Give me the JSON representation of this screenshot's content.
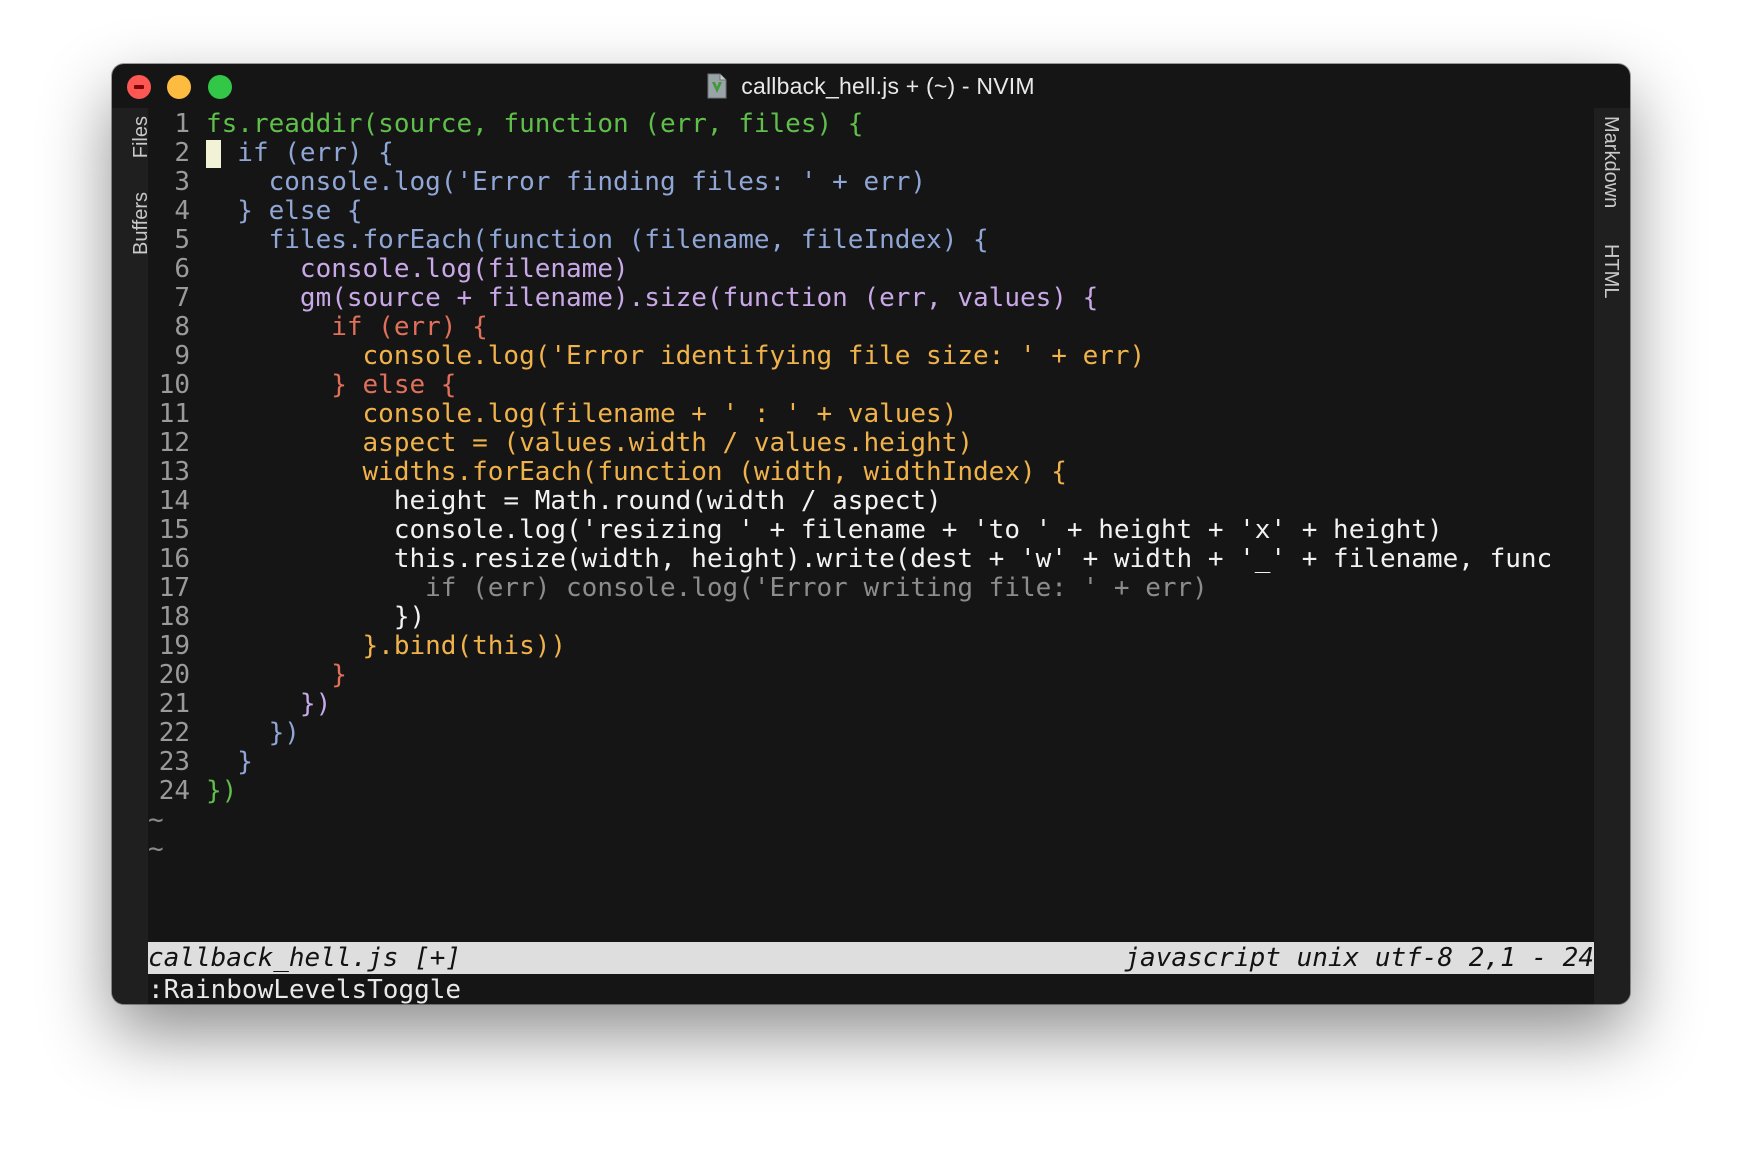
{
  "window": {
    "title": "callback_hell.js + (~) - NVIM"
  },
  "sidebar_left": {
    "tabs": [
      "Files",
      "Buffers"
    ]
  },
  "sidebar_right": {
    "tabs": [
      "Markdown",
      "HTML"
    ]
  },
  "editor": {
    "language": "javascript",
    "cursor": {
      "line": 2,
      "column": 1
    },
    "lines": [
      {
        "num": "1",
        "text": "fs.readdir(source, function (err, files) {",
        "color": "#5fbf4a"
      },
      {
        "num": "2",
        "text": "  if (err) {",
        "color": "#8fa6d6"
      },
      {
        "num": "3",
        "text": "    console.log('Error finding files: ' + err)",
        "color": "#8fa6d6"
      },
      {
        "num": "4",
        "text": "  } else {",
        "color": "#8fa6d6"
      },
      {
        "num": "5",
        "text": "    files.forEach(function (filename, fileIndex) {",
        "color": "#8fa6d6"
      },
      {
        "num": "6",
        "text": "      console.log(filename)",
        "color": "#c9a8e8"
      },
      {
        "num": "7",
        "text": "      gm(source + filename).size(function (err, values) {",
        "color": "#c9a8e8"
      },
      {
        "num": "8",
        "text": "        if (err) {",
        "color": "#e0705a"
      },
      {
        "num": "9",
        "text": "          console.log('Error identifying file size: ' + err)",
        "color": "#f0b24a"
      },
      {
        "num": "10",
        "text": "        } else {",
        "color": "#e0705a"
      },
      {
        "num": "11",
        "text": "          console.log(filename + ' : ' + values)",
        "color": "#f0b24a"
      },
      {
        "num": "12",
        "text": "          aspect = (values.width / values.height)",
        "color": "#f0b24a"
      },
      {
        "num": "13",
        "text": "          widths.forEach(function (width, widthIndex) {",
        "color": "#f0b24a"
      },
      {
        "num": "14",
        "text": "            height = Math.round(width / aspect)",
        "color": "#f2f2f2"
      },
      {
        "num": "15",
        "text": "            console.log('resizing ' + filename + 'to ' + height + 'x' + height)",
        "color": "#f2f2f2"
      },
      {
        "num": "16",
        "text": "            this.resize(width, height).write(dest + 'w' + width + '_' + filename, func",
        "color": "#f2f2f2"
      },
      {
        "num": "17",
        "text": "              if (err) console.log('Error writing file: ' + err)",
        "color": "#8c8c8c"
      },
      {
        "num": "18",
        "text": "            })",
        "color": "#f2f2f2"
      },
      {
        "num": "19",
        "text": "          }.bind(this))",
        "color": "#f0b24a"
      },
      {
        "num": "20",
        "text": "        }",
        "color": "#e0705a"
      },
      {
        "num": "21",
        "text": "      })",
        "color": "#c9a8e8"
      },
      {
        "num": "22",
        "text": "    })",
        "color": "#8fa6d6"
      },
      {
        "num": "23",
        "text": "  }",
        "color": "#8fa6d6"
      },
      {
        "num": "24",
        "text": "})",
        "color": "#5fbf4a"
      }
    ],
    "empty_line_markers": [
      "~",
      "~"
    ]
  },
  "statusline": {
    "left": "callback_hell.js [+]",
    "right": "javascript unix utf-8 2,1 - 24"
  },
  "cmdline": {
    "text": ":RainbowLevelsToggle"
  },
  "colors": {
    "background": "#151515",
    "level1": "#5fbf4a",
    "level2": "#8fa6d6",
    "level3": "#c9a8e8",
    "level4": "#e0705a",
    "level5": "#f0b24a",
    "level6": "#f2f2f2",
    "level7": "#8c8c8c"
  }
}
